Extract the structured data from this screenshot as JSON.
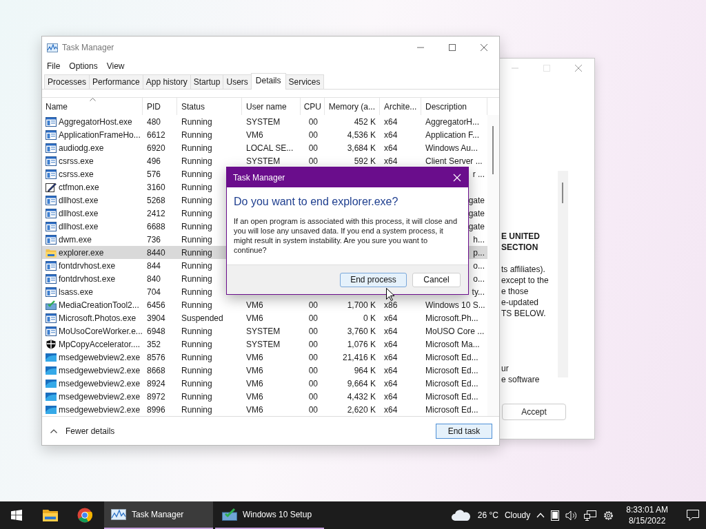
{
  "setup_window": {
    "headings": [
      "E UNITED",
      "SECTION"
    ],
    "paragraph": [
      "ts affiliates).",
      "except to the",
      "e those",
      "e-updated",
      "TS BELOW."
    ],
    "paragraph_2": [
      "ur",
      "e software"
    ],
    "button": "Accept"
  },
  "task_manager": {
    "title": "Task Manager",
    "menu": [
      "File",
      "Options",
      "View"
    ],
    "tabs": [
      {
        "label": "Processes",
        "selected": false
      },
      {
        "label": "Performance",
        "selected": false
      },
      {
        "label": "App history",
        "selected": false
      },
      {
        "label": "Startup",
        "selected": false
      },
      {
        "label": "Users",
        "selected": false
      },
      {
        "label": "Details",
        "selected": true
      },
      {
        "label": "Services",
        "selected": false
      }
    ],
    "columns": [
      {
        "label": "Name",
        "sorted": true
      },
      {
        "label": "PID",
        "sorted": false
      },
      {
        "label": "Status",
        "sorted": false
      },
      {
        "label": "User name",
        "sorted": false
      },
      {
        "label": "CPU",
        "sorted": false
      },
      {
        "label": "Memory (a...",
        "sorted": false
      },
      {
        "label": "Archite...",
        "sorted": false
      },
      {
        "label": "Description",
        "sorted": false
      }
    ],
    "rows": [
      {
        "kind": "app",
        "name": "AggregatorHost.exe",
        "pid": "480",
        "status": "Running",
        "user": "SYSTEM",
        "cpu": "00",
        "memory": "452 K",
        "arch": "x64",
        "description": "AggregatorH...",
        "selected": false,
        "obscured": false
      },
      {
        "kind": "app",
        "name": "ApplicationFrameHo...",
        "pid": "6612",
        "status": "Running",
        "user": "VM6",
        "cpu": "00",
        "memory": "4,536 K",
        "arch": "x64",
        "description": "Application F...",
        "selected": false,
        "obscured": false
      },
      {
        "kind": "app",
        "name": "audiodg.exe",
        "pid": "6920",
        "status": "Running",
        "user": "LOCAL SE...",
        "cpu": "00",
        "memory": "3,684 K",
        "arch": "x64",
        "description": "Windows Au...",
        "selected": false,
        "obscured": false
      },
      {
        "kind": "app",
        "name": "csrss.exe",
        "pid": "496",
        "status": "Running",
        "user": "SYSTEM",
        "cpu": "00",
        "memory": "592 K",
        "arch": "x64",
        "description": "Client Server ...",
        "selected": false,
        "obscured": false
      },
      {
        "kind": "app",
        "name": "csrss.exe",
        "pid": "576",
        "status": "Running",
        "description": "r ...",
        "selected": false,
        "obscured": true
      },
      {
        "kind": "editor",
        "name": "ctfmon.exe",
        "pid": "3160",
        "status": "Running",
        "selected": false
      },
      {
        "kind": "app",
        "name": "dllhost.exe",
        "pid": "5268",
        "status": "Running",
        "description": "gate",
        "selected": false,
        "obscured": true
      },
      {
        "kind": "app",
        "name": "dllhost.exe",
        "pid": "2412",
        "status": "Running",
        "description": "gate",
        "selected": false,
        "obscured": true
      },
      {
        "kind": "app",
        "name": "dllhost.exe",
        "pid": "6688",
        "status": "Running",
        "description": "gate",
        "selected": false,
        "obscured": true
      },
      {
        "kind": "app",
        "name": "dwm.exe",
        "pid": "736",
        "status": "Running",
        "description": "h...",
        "selected": false,
        "obscured": true
      },
      {
        "kind": "folder",
        "name": "explorer.exe",
        "pid": "8440",
        "status": "Running",
        "description": "p...",
        "selected": true,
        "obscured": true
      },
      {
        "kind": "app",
        "name": "fontdrvhost.exe",
        "pid": "844",
        "status": "Running",
        "description": "o...",
        "selected": false,
        "obscured": true
      },
      {
        "kind": "app",
        "name": "fontdrvhost.exe",
        "pid": "840",
        "status": "Running",
        "description": "o...",
        "selected": false,
        "obscured": true
      },
      {
        "kind": "app",
        "name": "lsass.exe",
        "pid": "704",
        "status": "Running",
        "description": "ty...",
        "selected": false,
        "obscured": true
      },
      {
        "kind": "setup",
        "name": "MediaCreationTool2...",
        "pid": "6456",
        "status": "Running",
        "user": "VM6",
        "cpu": "00",
        "memory": "1,700 K",
        "arch": "x86",
        "description": "Windows 10 S...",
        "selected": false,
        "obscured": false
      },
      {
        "kind": "app",
        "name": "Microsoft.Photos.exe",
        "pid": "3904",
        "status": "Suspended",
        "user": "VM6",
        "cpu": "00",
        "memory": "0 K",
        "arch": "x64",
        "description": "Microsoft.Ph...",
        "selected": false,
        "obscured": false
      },
      {
        "kind": "app",
        "name": "MoUsoCoreWorker.e...",
        "pid": "6948",
        "status": "Running",
        "user": "SYSTEM",
        "cpu": "00",
        "memory": "3,760 K",
        "arch": "x64",
        "description": "MoUSO Core ...",
        "selected": false,
        "obscured": false
      },
      {
        "kind": "shield",
        "name": "MpCopyAccelerator....",
        "pid": "352",
        "status": "Running",
        "user": "SYSTEM",
        "cpu": "00",
        "memory": "1,076 K",
        "arch": "x64",
        "description": "Microsoft Ma...",
        "selected": false,
        "obscured": false
      },
      {
        "kind": "webview",
        "name": "msedgewebview2.exe",
        "pid": "8576",
        "status": "Running",
        "user": "VM6",
        "cpu": "00",
        "memory": "21,416 K",
        "arch": "x64",
        "description": "Microsoft Ed...",
        "selected": false,
        "obscured": false
      },
      {
        "kind": "webview",
        "name": "msedgewebview2.exe",
        "pid": "8668",
        "status": "Running",
        "user": "VM6",
        "cpu": "00",
        "memory": "964 K",
        "arch": "x64",
        "description": "Microsoft Ed...",
        "selected": false,
        "obscured": false
      },
      {
        "kind": "webview",
        "name": "msedgewebview2.exe",
        "pid": "8924",
        "status": "Running",
        "user": "VM6",
        "cpu": "00",
        "memory": "9,664 K",
        "arch": "x64",
        "description": "Microsoft Ed...",
        "selected": false,
        "obscured": false
      },
      {
        "kind": "webview",
        "name": "msedgewebview2.exe",
        "pid": "8972",
        "status": "Running",
        "user": "VM6",
        "cpu": "00",
        "memory": "4,432 K",
        "arch": "x64",
        "description": "Microsoft Ed...",
        "selected": false,
        "obscured": false
      },
      {
        "kind": "webview",
        "name": "msedgewebview2.exe",
        "pid": "8996",
        "status": "Running",
        "user": "VM6",
        "cpu": "00",
        "memory": "2,620 K",
        "arch": "x64",
        "description": "Microsoft Ed...",
        "selected": false,
        "obscured": false
      }
    ],
    "footer": {
      "toggle": "Fewer details",
      "button": "End task"
    }
  },
  "dialog": {
    "title": "Task Manager",
    "heading": "Do you want to end explorer.exe?",
    "message": "If an open program is associated with this process, it will close and you will lose any unsaved data. If you end a system process, it might result in system instability. Are you sure you want to continue?",
    "buttons": [
      {
        "label": "End process",
        "focused": true
      },
      {
        "label": "Cancel",
        "focused": false
      }
    ]
  },
  "taskbar": {
    "pinned": [
      {
        "kind": "folder"
      },
      {
        "kind": "browser"
      }
    ],
    "windows": [
      {
        "kind": "monitor",
        "label": "Task Manager",
        "active": true
      },
      {
        "kind": "setup",
        "label": "Windows 10 Setup",
        "active": false
      }
    ],
    "weather": {
      "temperature": "26 °C",
      "condition": "Cloudy"
    },
    "time": "8:33:01 AM",
    "date": "8/15/2022"
  }
}
